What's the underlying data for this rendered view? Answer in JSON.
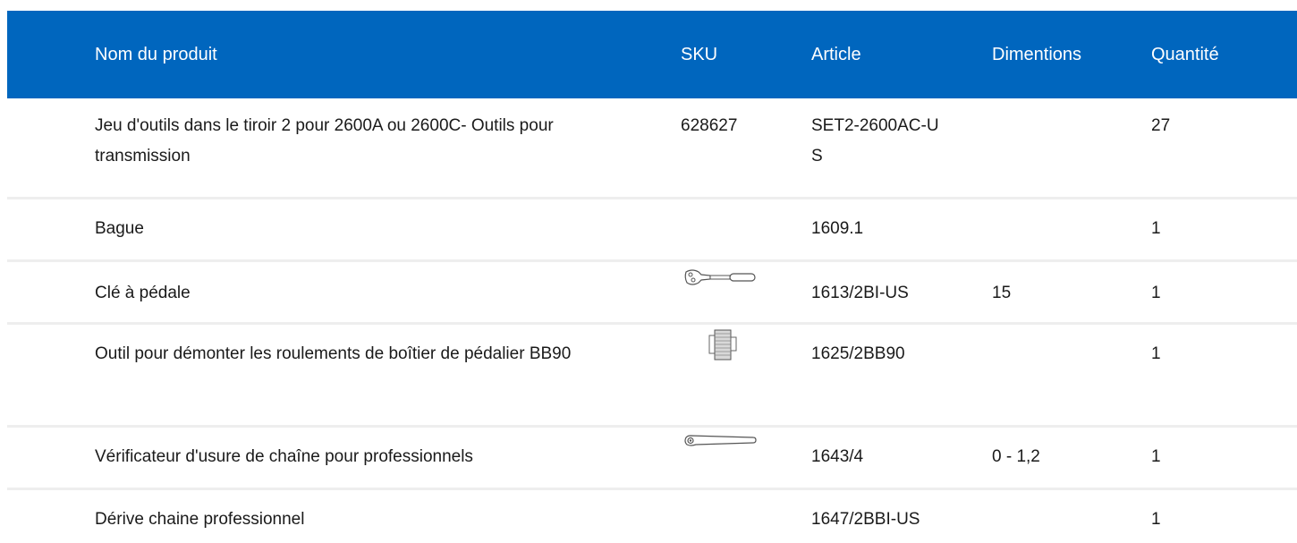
{
  "table": {
    "headers": {
      "name": "Nom du produit",
      "sku": "SKU",
      "article": "Article",
      "dimensions": "Dimentions",
      "quantity": "Quantité"
    },
    "rows": [
      {
        "name": "Jeu d'outils dans le tiroir 2 pour 2600A ou 2600C- Outils pour transmission",
        "sku": "628627",
        "sku_icon": "",
        "article": "SET2-2600AC-US",
        "dimensions": "",
        "quantity": "27"
      },
      {
        "name": "Bague",
        "sku": "",
        "sku_icon": "",
        "article": "1609.1",
        "dimensions": "",
        "quantity": "1"
      },
      {
        "name": "Clé à pédale",
        "sku": "",
        "sku_icon": "pedal-wrench-icon",
        "article": "1613/2BI-US",
        "dimensions": "15",
        "quantity": "1"
      },
      {
        "name": "Outil pour démonter les roulements de boîtier de pédalier BB90",
        "sku": "",
        "sku_icon": "bottom-bracket-tool-icon",
        "article": "1625/2BB90",
        "dimensions": "",
        "quantity": "1"
      },
      {
        "name": "Vérificateur d'usure de chaîne pour professionnels",
        "sku": "",
        "sku_icon": "chain-checker-icon",
        "article": "1643/4",
        "dimensions": "0 - 1,2",
        "quantity": "1"
      },
      {
        "name": "Dérive chaine professionnel",
        "sku": "",
        "sku_icon": "",
        "article": "1647/2BBI-US",
        "dimensions": "",
        "quantity": "1"
      }
    ]
  },
  "colors": {
    "header_bg": "#0066be",
    "header_text": "#ffffff",
    "row_divider": "#eeeeee",
    "body_text": "#1a1a1a"
  }
}
